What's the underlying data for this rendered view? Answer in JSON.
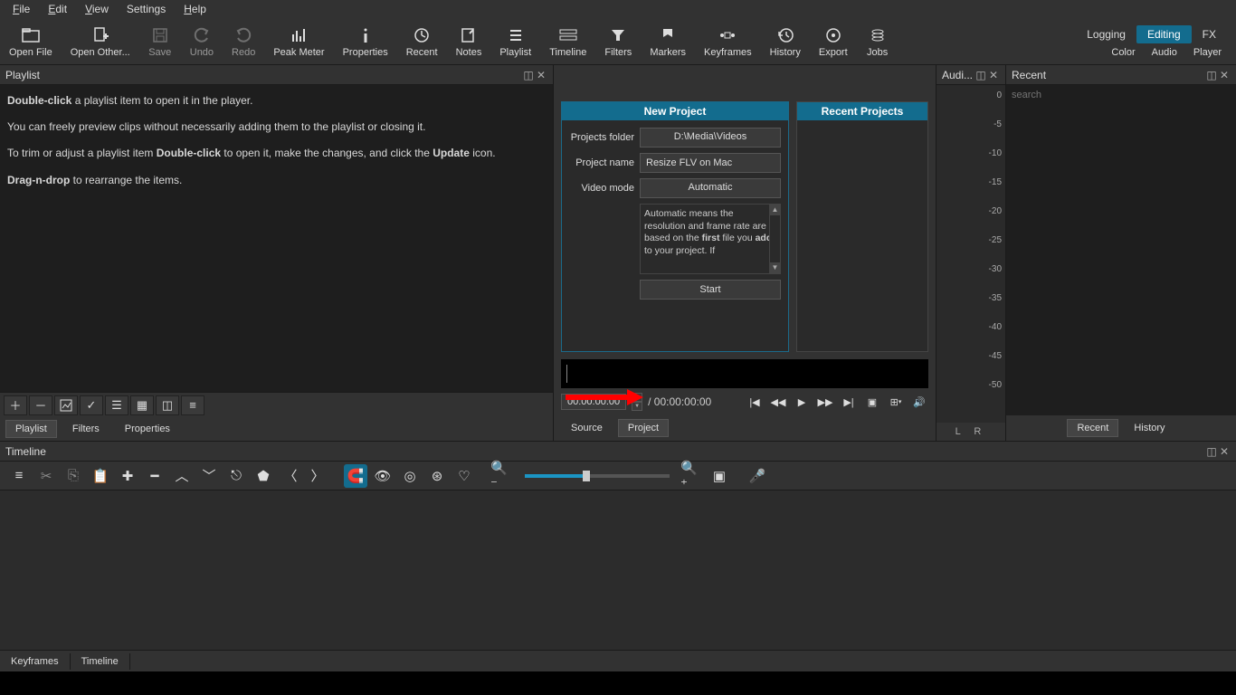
{
  "menu": {
    "file": "File",
    "edit": "Edit",
    "view": "View",
    "settings": "Settings",
    "help": "Help"
  },
  "toolbar": {
    "open_file": "Open File",
    "open_other": "Open Other...",
    "save": "Save",
    "undo": "Undo",
    "redo": "Redo",
    "peak_meter": "Peak Meter",
    "properties": "Properties",
    "recent": "Recent",
    "notes": "Notes",
    "playlist": "Playlist",
    "timeline": "Timeline",
    "filters": "Filters",
    "markers": "Markers",
    "keyframes": "Keyframes",
    "history": "History",
    "export": "Export",
    "jobs": "Jobs"
  },
  "top_tabs": {
    "logging": "Logging",
    "editing": "Editing",
    "fx": "FX"
  },
  "sub_tabs": {
    "color": "Color",
    "audio": "Audio",
    "player": "Player"
  },
  "playlist": {
    "title": "Playlist",
    "p1a": "Double-click",
    "p1b": " a playlist item to open it in the player.",
    "p2": "You can freely preview clips without necessarily adding them to the playlist or closing it.",
    "p3a": "To trim or adjust a playlist item ",
    "p3b": "Double-click",
    "p3c": " to open it, make the changes, and click the ",
    "p3d": "Update",
    "p3e": " icon.",
    "p4a": "Drag-n-drop",
    "p4b": " to rearrange the items."
  },
  "left_tabs": {
    "playlist": "Playlist",
    "filters": "Filters",
    "properties": "Properties"
  },
  "new_project": {
    "title": "New Project",
    "folder_label": "Projects folder",
    "folder_value": "D:\\Media\\Videos",
    "name_label": "Project name",
    "name_value": "Resize FLV on Mac",
    "mode_label": "Video mode",
    "mode_value": "Automatic",
    "desc_a": "Automatic means the resolution and frame rate are based on the ",
    "desc_b": "first",
    "desc_c": " file you ",
    "desc_d": "add",
    "desc_e": " to your project. If",
    "start": "Start"
  },
  "recent_projects": {
    "title": "Recent Projects"
  },
  "transport": {
    "tc1": "00:00:00:00",
    "tc2": "/ 00:00:00:00"
  },
  "center_tabs": {
    "source": "Source",
    "project": "Project"
  },
  "audio_panel": {
    "title": "Audi...",
    "lr": "L   R"
  },
  "meter_ticks": [
    "0",
    "-5",
    "-10",
    "-15",
    "-20",
    "-25",
    "-30",
    "-35",
    "-40",
    "-45",
    "-50"
  ],
  "recent_panel": {
    "title": "Recent",
    "search_placeholder": "search",
    "tab_recent": "Recent",
    "tab_history": "History"
  },
  "timeline": {
    "title": "Timeline"
  },
  "bottom_tabs": {
    "keyframes": "Keyframes",
    "timeline": "Timeline"
  }
}
